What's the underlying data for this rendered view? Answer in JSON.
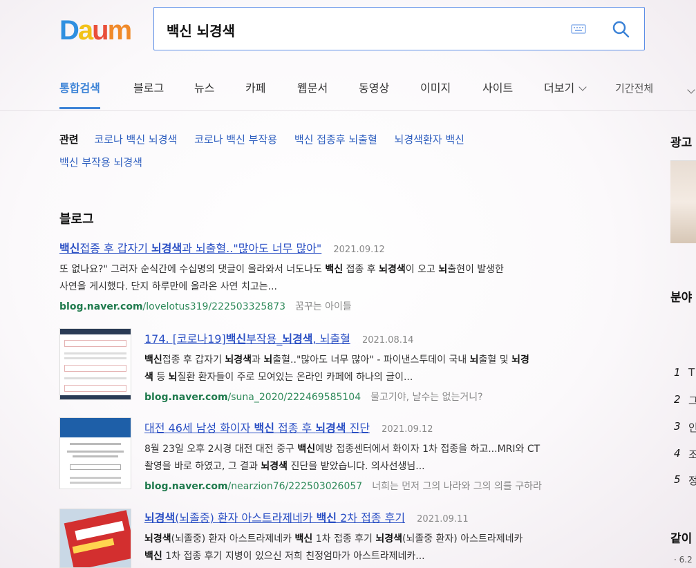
{
  "logo": {
    "letters": [
      "D",
      "a",
      "u",
      "m"
    ],
    "colors": [
      "#2f8fe0",
      "#f2c21a",
      "#e94f3a",
      "#f08a2a"
    ]
  },
  "search": {
    "value": "백신 뇌경색"
  },
  "nav": {
    "items": [
      "통합검색",
      "블로그",
      "뉴스",
      "카페",
      "웹문서",
      "동영상",
      "이미지",
      "사이트",
      "더보기"
    ],
    "period": "기간전체",
    "accent": "#3b82d6"
  },
  "related": {
    "title": "관련",
    "links": [
      "코로나 백신 뇌경색",
      "코로나 백신 부작용",
      "백신 접종후 뇌출혈",
      "뇌경색환자 백신",
      "백신 부작용 뇌경색"
    ]
  },
  "section": {
    "title": "블로그"
  },
  "results": [
    {
      "title_b1": "백신",
      "title_1": "접종 후 갑자기 ",
      "title_b2": "뇌경색",
      "title_2": "과 뇌출혈..\"많아도 너무 많아\"",
      "date": "2021.09.12",
      "desc1": "또 없나요?\"  그러자 순식간에 수십명의 댓글이 올라와서 너도나도 ",
      "desc1_b": "백신",
      "desc1_2": " 접종 후 ",
      "desc1_b2": "뇌경색",
      "desc1_3": "이 오고 ",
      "desc1_b3": "뇌",
      "desc1_4": "출현이 발생한",
      "desc2": "사연을 게시했다.  단지 하루만에 올라온 사연 치고는...",
      "domain": "blog.naver.com",
      "path": "/lovelotus319/222503325873",
      "blog": "꿈꾸는 아이들"
    },
    {
      "title": "174. [코로나19]",
      "title_b1": "백신",
      "title_1": "부작용_",
      "title_b2": "뇌경색",
      "title_2": ", 뇌출혈",
      "date": "2021.08.14",
      "desc1_b": "백신",
      "desc1": "접종 후 갑자기 ",
      "desc1_b2": "뇌경색",
      "desc1_2": "과 ",
      "desc1_b3": "뇌",
      "desc1_3": "출혈..\"많아도 너무 많아\" - 파이낸스투데이 국내 ",
      "desc1_b4": "뇌",
      "desc1_4": "출혈 및 ",
      "desc1_b5": "뇌경",
      "desc2_b": "색",
      "desc2": " 등 ",
      "desc2_b2": "뇌",
      "desc2_2": "질환 환자들이 주로 모여있는 온라인 카페에 하나의 글이...",
      "domain": "blog.naver.com",
      "path": "/suna_2020/222469585104",
      "blog": "물고기야, 날수는 없는거니?"
    },
    {
      "title_1": "대전 46세 남성 화이자 ",
      "title_b1": "백신",
      "title_2": " 접종 후 ",
      "title_b2": "뇌경색",
      "title_3": " 진단",
      "date": "2021.09.12",
      "desc1": "8월 23일 오후 2시경 대전 대전 중구 ",
      "desc1_b": "백신",
      "desc1_2": "예방 접종센터에서 화이자 1차 접종을 하고...MRI와 CT",
      "desc2": "촬영을 바로 하였고, 그 결과 ",
      "desc2_b": "뇌경색",
      "desc2_2": " 진단을 받았습니다. 의사선생님...",
      "domain": "blog.naver.com",
      "path": "/nearzion76/222503026057",
      "blog": "너희는 먼저 그의 나라와 그의 의를 구하라"
    },
    {
      "title_b1": "뇌경색",
      "title_1": "(뇌졸중) 환자 아스트라제네카 ",
      "title_b2": "백신",
      "title_2": " 2차 접종 후기",
      "date": "2021.09.11",
      "desc1_b": "뇌경색",
      "desc1": "(뇌졸중) 환자 아스트라제네카 ",
      "desc1_b2": "백신",
      "desc1_2": " 1차 접종 후기 ",
      "desc1_b3": "뇌경색",
      "desc1_3": "(뇌졸중 환자) 아스트라제네카",
      "desc2_b": "백신",
      "desc2": " 1차 접종 후기 지병이 있으신 저희 친정엄마가 아스트라제네카..."
    }
  ],
  "side": {
    "ad": "광고",
    "field": "분야",
    "same": "같이",
    "ranks": [
      "1",
      "2",
      "3",
      "4",
      "5"
    ],
    "rank_initials": [
      "T",
      "그",
      "인",
      "조",
      "정"
    ],
    "small": "· 6.2"
  }
}
